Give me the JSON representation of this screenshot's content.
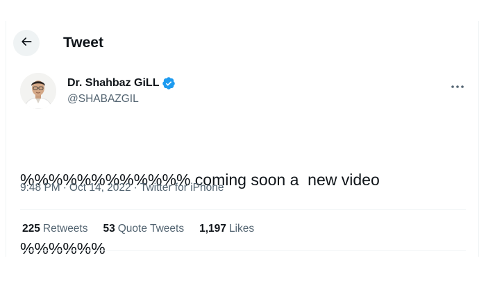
{
  "header": {
    "title": "Tweet",
    "back_icon": "arrow-left-icon"
  },
  "author": {
    "display_name": "Dr. Shahbaz GiLL",
    "handle": "@SHABAZGIL",
    "verified": true,
    "verified_color": "#1d9bf0"
  },
  "more_icon": "more-horizontal-icon",
  "tweet": {
    "text_line1": "%%%%%%%%%%%% coming soon a  new video",
    "text_line2": "%%%%%%"
  },
  "meta": {
    "time": "9:48 PM",
    "separator": "·",
    "date": "Oct 14, 2022",
    "source": "Twitter for iPhone"
  },
  "stats": [
    {
      "count": "225",
      "label": "Retweets"
    },
    {
      "count": "53",
      "label": "Quote Tweets"
    },
    {
      "count": "1,197",
      "label": "Likes"
    }
  ]
}
